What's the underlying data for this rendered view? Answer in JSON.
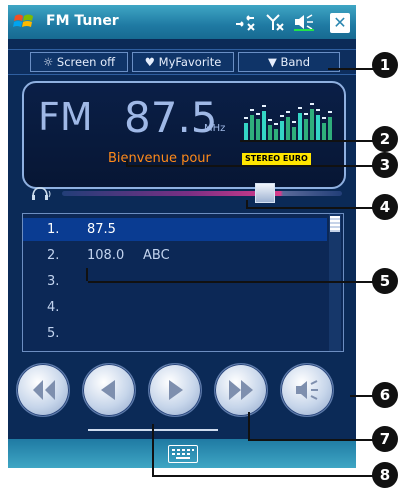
{
  "window": {
    "title": "FM Tuner",
    "close_label": "✕"
  },
  "toolbar": {
    "screen_off_label": "Screen off",
    "favorite_label": "MyFavorite",
    "band_label": "Band"
  },
  "display": {
    "band": "FM",
    "frequency": "87.5",
    "unit": "MHz",
    "rds_text": "Bienvenue pour",
    "stereo_badge": "STEREO  EURO"
  },
  "volume": {
    "level": 0.72
  },
  "presets": [
    {
      "num": "1.",
      "freq": "87.5",
      "name": "",
      "selected": true
    },
    {
      "num": "2.",
      "freq": "108.0",
      "name": "ABC",
      "selected": false
    },
    {
      "num": "3.",
      "freq": "",
      "name": "",
      "selected": false
    },
    {
      "num": "4.",
      "freq": "",
      "name": "",
      "selected": false
    },
    {
      "num": "5.",
      "freq": "",
      "name": "",
      "selected": false
    }
  ],
  "controls": [
    {
      "name": "seek-back",
      "icon": "double-left-arrow-icon"
    },
    {
      "name": "step-back",
      "icon": "left-arrow-icon"
    },
    {
      "name": "step-forward",
      "icon": "right-arrow-icon"
    },
    {
      "name": "seek-forward",
      "icon": "double-right-arrow-icon"
    },
    {
      "name": "mute",
      "icon": "speaker-icon"
    }
  ],
  "callouts": [
    "1",
    "2",
    "3",
    "4",
    "5",
    "6",
    "7",
    "8"
  ],
  "colors": {
    "screen_bg": "#0b2a57",
    "accent": "#2a86b0",
    "rds": "#ff8a1a",
    "badge": "#ffe500"
  }
}
